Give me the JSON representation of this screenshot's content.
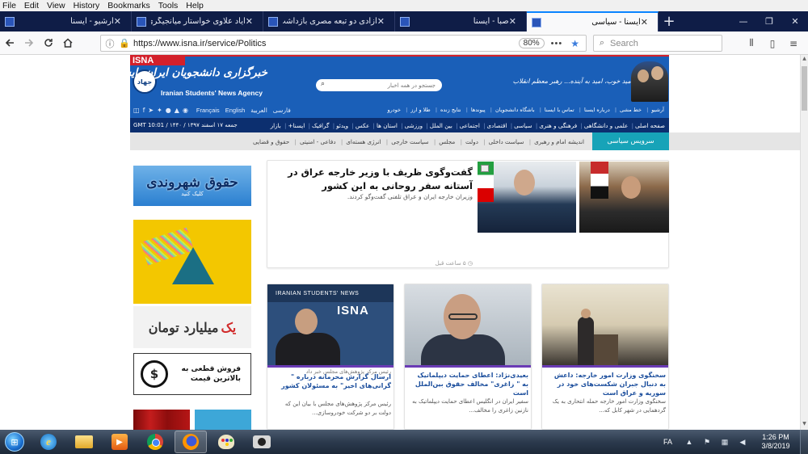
{
  "menubar": [
    "File",
    "Edit",
    "View",
    "History",
    "Bookmarks",
    "Tools",
    "Help"
  ],
  "tabs": [
    {
      "title": "آرشیو - ایسنا"
    },
    {
      "title": "ایاد علاوی خواستار میانجیگری کش..."
    },
    {
      "title": "آزادی دو تبعه مصری بازداشت شده"
    },
    {
      "title": "صبا - ایسنا"
    },
    {
      "title": "ایسنا - سیاسی",
      "active": true
    }
  ],
  "window_controls": [
    "—",
    "❐",
    "✕"
  ],
  "url": "https://www.isna.ir/service/Politics",
  "zoom": "80%",
  "search_placeholder": "Search",
  "site": {
    "tag": "ISNA",
    "logo_fa": "خبرگزاری دانشجویان ایران، ایسنا",
    "logo_en": "Iranian Students' News Agency",
    "emblem": "جهاد",
    "search_placeholder": "جستجو در همه اخبار",
    "leader_quote": "امید خوب، امید به آینده... رهبر معظم انقلاب",
    "languages": [
      "فارسی",
      "العربية",
      "English",
      "Français"
    ],
    "top_links": [
      "آرشیو",
      "خط مشی",
      "درباره ایسنا",
      "تماس با ایسنا",
      "باشگاه دانشجویان",
      "پیوندها",
      "نتایج زنده",
      "طلا و ارز",
      "خودرو"
    ],
    "date": "جمعه ۱۷ اسفند ۱۳۹۷ / ۱۴۴۰ / GMT 10:01",
    "main_nav": [
      "صفحه اصلی",
      "علمی و دانشگاهی",
      "فرهنگی و هنری",
      "سیاسی",
      "اقتصادی",
      "اجتماعی",
      "بین الملل",
      "ورزشی",
      "استان ها",
      "عکس",
      "ویدئو",
      "گرافیک",
      "ایسنا+",
      "بازار"
    ],
    "section_title": "سرویس سیاسی",
    "section_links": [
      "اندیشه امام و رهبری",
      "سیاست داخلی",
      "دولت",
      "مجلس",
      "سیاست خارجی",
      "انرژی هسته‌ای",
      "دفاعی - امنیتی",
      "حقوق و قضایی"
    ]
  },
  "sidebar": {
    "rights_big": "حقوق شهروندی",
    "rights_small": "کلیک کنید",
    "billion_red": "یک",
    "billion_dark": "میلیارد تومان",
    "sell_text": "فروش قطعی به بالاترین قیمت",
    "sell_icon": "$"
  },
  "lead": {
    "title": "گفت‌وگوی ظریف با وزیر خارجه عراق در آستانه سفر روحانی به این کشور",
    "summary": "وزیران خارجه ایران و عراق تلفنی گفت‌وگو کردند.",
    "time": "۵ ساعت قبل"
  },
  "cards": [
    {
      "title": "سخنگوی وزارت امور خارجه: داعش به دنبال جبران شکست‌های خود در سوریه و عراق است",
      "summary": "سخنگوی وزارت امور خارجه حمله انتحاری به یک گردهمایی در شهر کابل که..."
    },
    {
      "title": "بعیدی‌نژاد: اعطای حمایت دیپلماتیک به \" زاغری\" مخالف حقوق بین‌الملل است",
      "summary": "سفیر ایران در انگلیس اعطای حمایت دیپلماتیک به نازنین زاغری را مخالف..."
    },
    {
      "pre": "رئیس مرکز پژوهش‌های مجلس خبر داد",
      "title": "ارسال گزارش محرمانه درباره \" گرانی‌های اخیر\" به مسئولان کشور",
      "summary": "رئیس مرکز پژوهش‌های مجلس با بیان این که دولت بر دو شرکت خودروسازی...",
      "photo_band": "IRANIAN STUDENTS' NEWS",
      "photo_logo": "ISNA"
    }
  ],
  "taskbar": {
    "lang": "FA",
    "time": "1:26 PM",
    "date": "3/8/2019"
  }
}
